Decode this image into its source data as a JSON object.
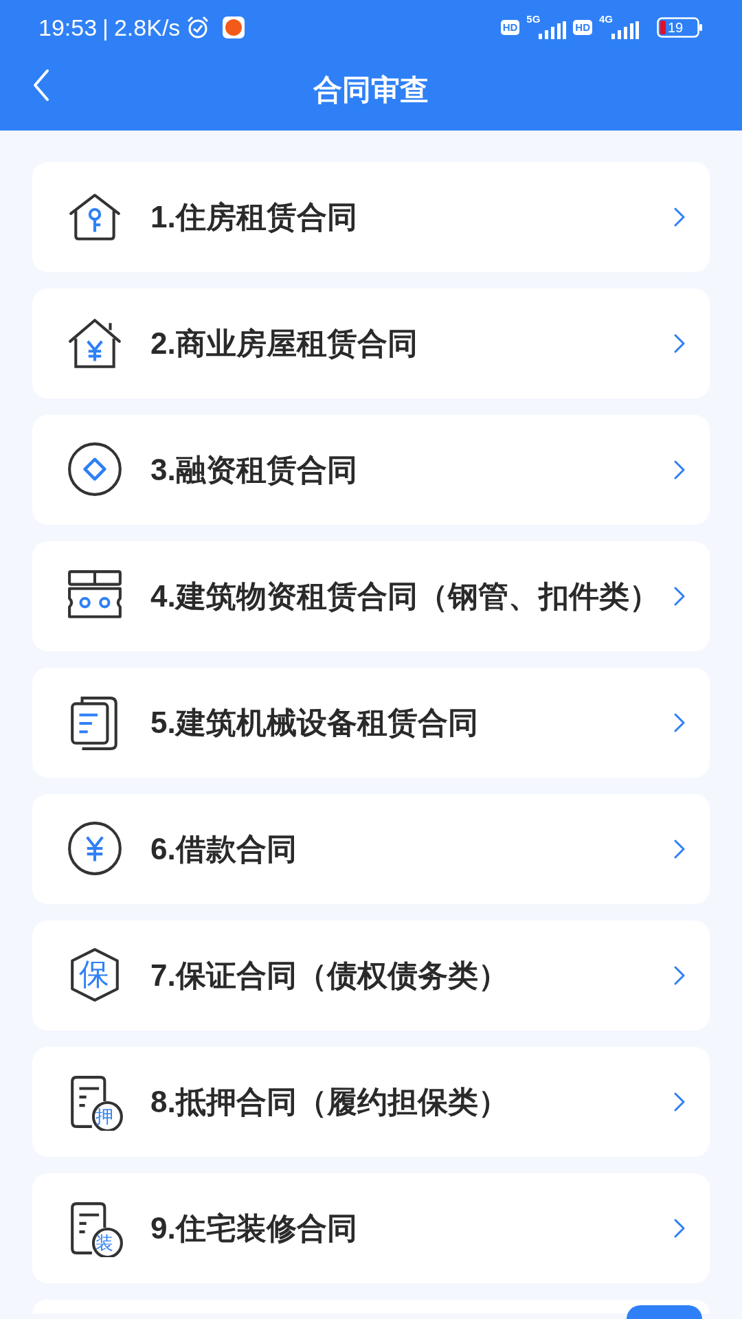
{
  "status_bar": {
    "time": "19:53",
    "separator": "|",
    "speed": "2.8K/s",
    "sim1": {
      "hd": "HD",
      "network": "5G"
    },
    "sim2": {
      "hd": "HD",
      "network": "4G"
    },
    "battery": "19"
  },
  "header": {
    "title": "合同审查"
  },
  "items": [
    {
      "label": "1.住房租赁合同",
      "kind": "house-key"
    },
    {
      "label": "2.商业房屋租赁合同",
      "kind": "house-yen"
    },
    {
      "label": "3.融资租赁合同",
      "kind": "circle-diamond"
    },
    {
      "label": "4.建筑物资租赁合同（钢管、扣件类）",
      "kind": "scaffold"
    },
    {
      "label": "5.建筑机械设备租赁合同",
      "kind": "documents"
    },
    {
      "label": "6.借款合同",
      "kind": "circle-yen"
    },
    {
      "label": "7.保证合同（债权债务类）",
      "kind": "hexagon-char",
      "icon_text": "保"
    },
    {
      "label": "8.抵押合同（履约担保类）",
      "kind": "doc-char",
      "icon_text": "押"
    },
    {
      "label": "9.住宅装修合同",
      "kind": "doc-char",
      "icon_text": "装"
    }
  ]
}
